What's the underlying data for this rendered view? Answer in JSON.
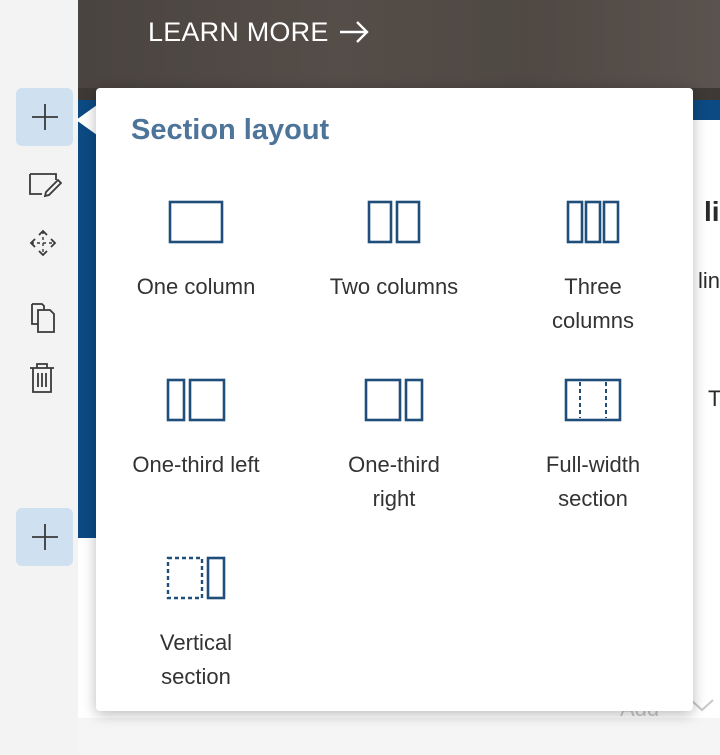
{
  "hero": {
    "learn_more": "LEARN MORE"
  },
  "popup": {
    "title": "Section layout",
    "options": [
      {
        "label": "One column",
        "icon": "one-column-icon"
      },
      {
        "label": "Two columns",
        "icon": "two-columns-icon"
      },
      {
        "label": "Three columns",
        "icon": "three-columns-icon"
      },
      {
        "label": "One-third left",
        "icon": "one-third-left-icon"
      },
      {
        "label": "One-third right",
        "icon": "one-third-right-icon"
      },
      {
        "label": "Full-width section",
        "icon": "full-width-section-icon"
      },
      {
        "label": "Vertical section",
        "icon": "vertical-section-icon"
      }
    ]
  },
  "background": {
    "partial_heading": "li",
    "partial_line": "lin",
    "partial_t": "T",
    "partial_add": "Add"
  },
  "colors": {
    "accent": "#0c4a84",
    "title": "#4d7499",
    "icon": "#1f4e7a",
    "tool_button": "#cfe0f1"
  },
  "toolbar": [
    {
      "name": "add-section-top",
      "icon": "plus-icon"
    },
    {
      "name": "edit-section",
      "icon": "edit-icon"
    },
    {
      "name": "move-section",
      "icon": "move-icon"
    },
    {
      "name": "duplicate-section",
      "icon": "copy-icon"
    },
    {
      "name": "delete-section",
      "icon": "trash-icon"
    },
    {
      "name": "add-section-bottom",
      "icon": "plus-icon"
    }
  ]
}
